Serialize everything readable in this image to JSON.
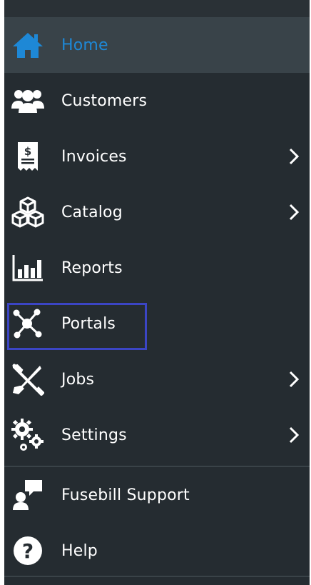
{
  "nav": {
    "items": [
      {
        "label": "Home",
        "icon": "home-icon"
      },
      {
        "label": "Customers",
        "icon": "customers-icon"
      },
      {
        "label": "Invoices",
        "icon": "invoice-icon"
      },
      {
        "label": "Catalog",
        "icon": "catalog-icon"
      },
      {
        "label": "Reports",
        "icon": "reports-icon"
      },
      {
        "label": "Portals",
        "icon": "portals-icon"
      },
      {
        "label": "Jobs",
        "icon": "jobs-icon"
      },
      {
        "label": "Settings",
        "icon": "settings-icon"
      },
      {
        "label": "Fusebill Support",
        "icon": "support-icon"
      },
      {
        "label": "Help",
        "icon": "help-icon"
      }
    ],
    "active_item": "Home",
    "highlighted_item": "Portals"
  },
  "colors": {
    "sidebar_bg": "#252c31",
    "active_bg": "#394349",
    "accent": "#1e88d6",
    "highlight_border": "#3b45c4"
  }
}
